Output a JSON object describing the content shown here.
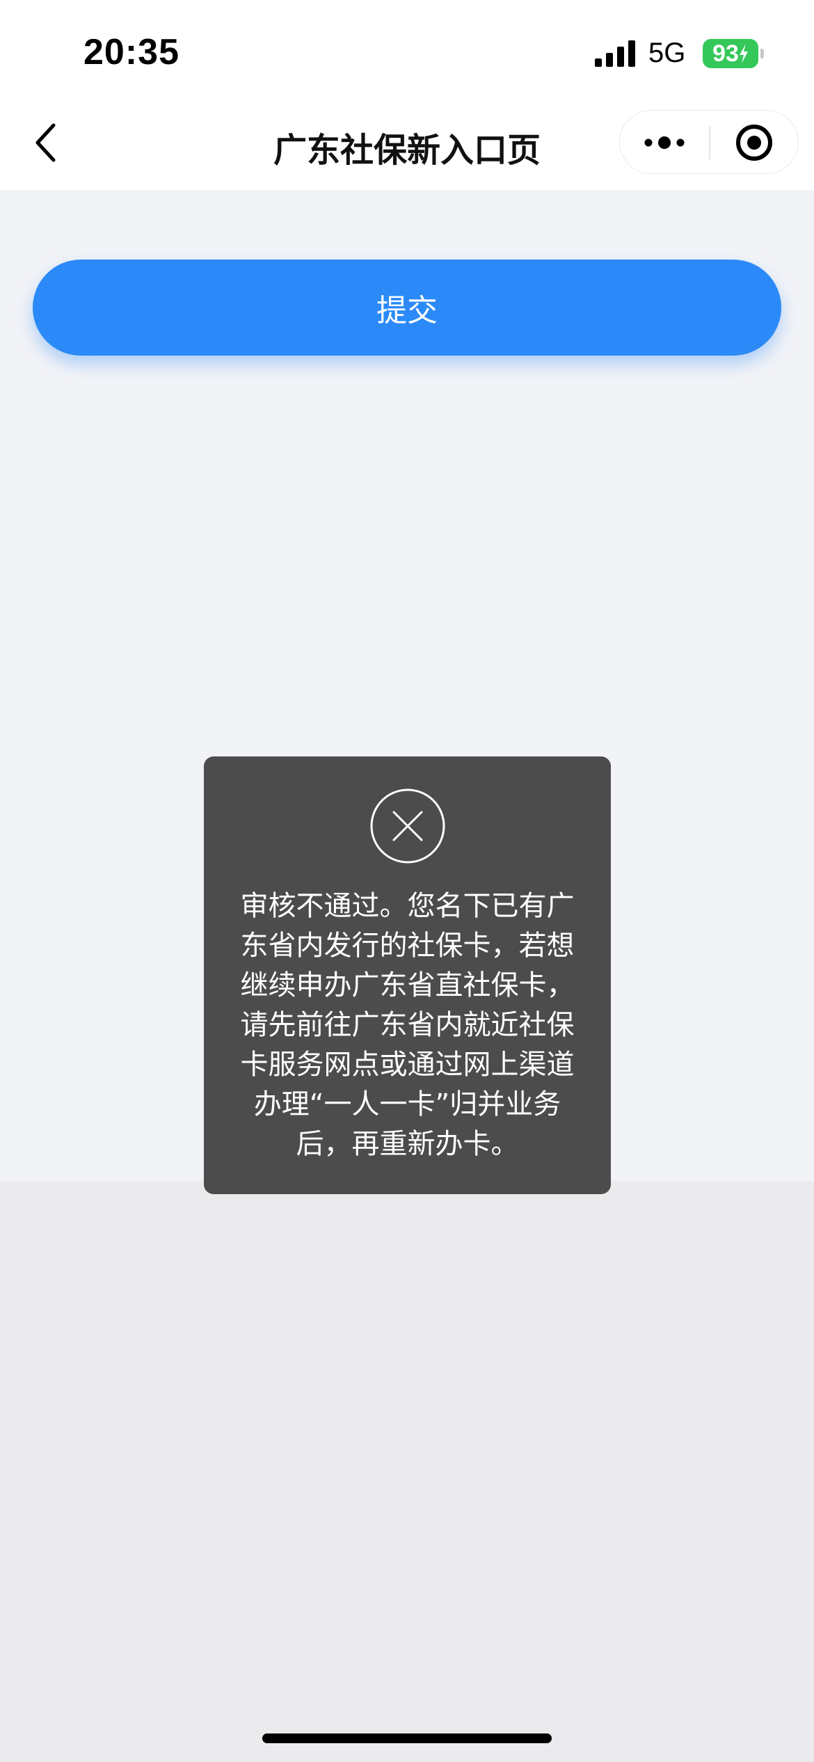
{
  "status_bar": {
    "time": "20:35",
    "network": "5G",
    "battery": "93"
  },
  "nav": {
    "title": "广东社保新入口页",
    "back_icon": "chevron-left-icon",
    "more_icon": "more-dots-icon",
    "close_icon": "target-close-icon"
  },
  "main": {
    "submit_label": "提交"
  },
  "toast": {
    "icon": "close-circle-icon",
    "message": "审核不通过。您名下已有广东省内发行的社保卡，若想继续申办广东省直社保卡，请先前往广东省内就近社保卡服务网点或通过网上渠道办理“一人一卡”归并业务后，再重新办卡。"
  },
  "colors": {
    "accent": "#2b8af7",
    "battery": "#34c759",
    "toast_bg": "#4c4c4c",
    "content_bg": "#f2f3f7"
  }
}
